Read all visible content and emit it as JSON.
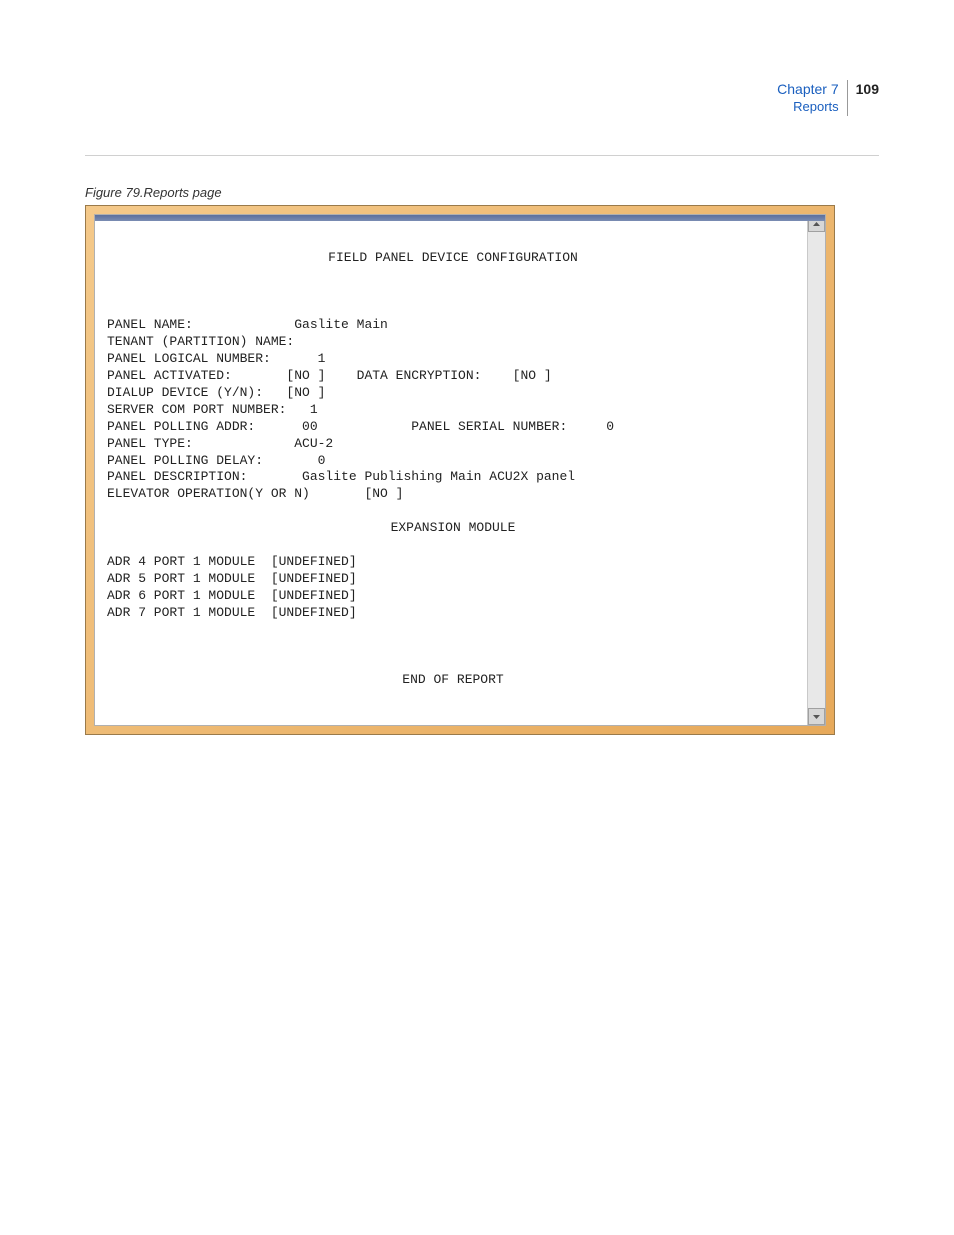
{
  "header": {
    "chapter": "Chapter 7",
    "section": "Reports",
    "page": "109"
  },
  "figure": {
    "caption": "Figure 79.Reports page"
  },
  "report": {
    "title": "FIELD PANEL DEVICE CONFIGURATION",
    "lines": {
      "panel_name": "PANEL NAME:             Gaslite Main",
      "tenant": "TENANT (PARTITION) NAME:",
      "panel_logical": "PANEL LOGICAL NUMBER:      1",
      "panel_activated": "PANEL ACTIVATED:       [NO ]    DATA ENCRYPTION:    [NO ]",
      "dialup": "DIALUP DEVICE (Y/N):   [NO ]",
      "server_com": "SERVER COM PORT NUMBER:   1",
      "polling_addr": "PANEL POLLING ADDR:      00            PANEL SERIAL NUMBER:     0",
      "panel_type": "PANEL TYPE:             ACU-2",
      "polling_delay": "PANEL POLLING DELAY:       0",
      "description": "PANEL DESCRIPTION:       Gaslite Publishing Main ACU2X panel",
      "elevator": "ELEVATOR OPERATION(Y OR N)       [NO ]"
    },
    "section": "EXPANSION MODULE",
    "modules": {
      "m1": "ADR 4 PORT 1 MODULE  [UNDEFINED]",
      "m2": "ADR 5 PORT 1 MODULE  [UNDEFINED]",
      "m3": "ADR 6 PORT 1 MODULE  [UNDEFINED]",
      "m4": "ADR 7 PORT 1 MODULE  [UNDEFINED]"
    },
    "footer": "END OF REPORT"
  }
}
